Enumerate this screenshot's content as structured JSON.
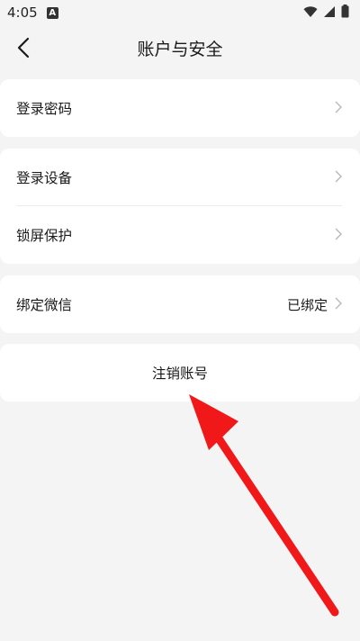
{
  "status_bar": {
    "time": "4:05",
    "a_badge": "A",
    "icons": [
      "wifi-icon",
      "signal-icon",
      "battery-icon"
    ]
  },
  "header": {
    "title": "账户与安全",
    "back_icon": "chevron-left-icon"
  },
  "sections": {
    "login_password": {
      "label": "登录密码"
    },
    "login_devices": {
      "label": "登录设备"
    },
    "lock_screen": {
      "label": "锁屏保护"
    },
    "wechat": {
      "label": "绑定微信",
      "value": "已绑定"
    },
    "cancel_account": {
      "label": "注销账号"
    }
  },
  "annotation": {
    "color": "#f01818",
    "type": "red-arrow"
  },
  "colors": {
    "background": "#f4f4f4",
    "card": "#ffffff",
    "chevron": "#b5b5b5"
  }
}
